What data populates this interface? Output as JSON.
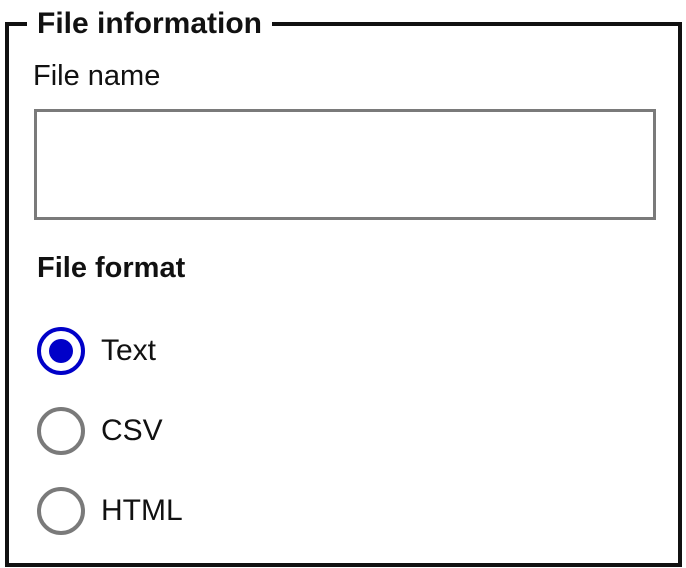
{
  "form": {
    "legend": "File information",
    "file_name": {
      "label": "File name",
      "value": ""
    },
    "file_format": {
      "label": "File format",
      "selected": "Text",
      "options": [
        {
          "label": "Text",
          "checked": true
        },
        {
          "label": "CSV",
          "checked": false
        },
        {
          "label": "HTML",
          "checked": false
        }
      ]
    }
  },
  "colors": {
    "border": "#111111",
    "input_border": "#7a7a7a",
    "radio_unchecked": "#7a7a7a",
    "radio_checked": "#0000c8"
  }
}
